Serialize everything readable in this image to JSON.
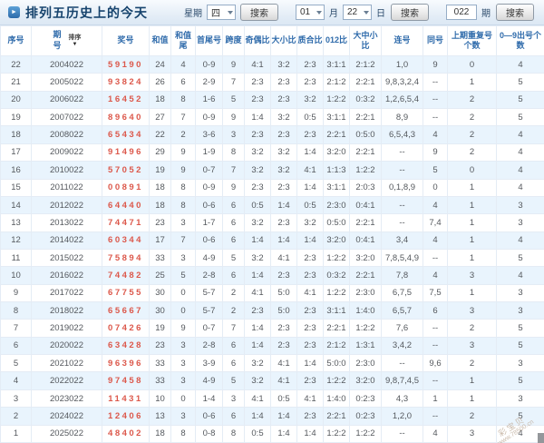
{
  "header": {
    "title": "排列五历史上的今天",
    "week_label": "星期",
    "week_value": "四",
    "month_value": "01",
    "month_label": "月",
    "day_value": "22",
    "day_label": "日",
    "issue_value": "022",
    "issue_label": "期",
    "search_label": "搜索"
  },
  "table": {
    "sort_label": "排序",
    "sort_arrow": "▼",
    "columns": [
      "序号",
      "期号",
      "奖号",
      "和值",
      "和值尾",
      "首尾号",
      "跨度",
      "奇偶比",
      "大小比",
      "质合比",
      "012比",
      "大中小比",
      "连号",
      "同号",
      "上期重复号个数",
      "0—9出号个数"
    ],
    "col_keys": [
      "seq",
      "issue",
      "number",
      "sum",
      "sum-tail",
      "first-last",
      "span",
      "odd-even-ratio",
      "big-small-ratio",
      "prime-composite-ratio",
      "zero12-ratio",
      "big-mid-small-ratio",
      "consecutive",
      "same",
      "prev-repeat-count",
      "digit-count"
    ],
    "rows": [
      [
        "22",
        "2004022",
        "59190",
        "24",
        "4",
        "0-9",
        "9",
        "4:1",
        "3:2",
        "2:3",
        "3:1:1",
        "2:1:2",
        "1,0",
        "9",
        "0",
        "4"
      ],
      [
        "21",
        "2005022",
        "93824",
        "26",
        "6",
        "2-9",
        "7",
        "2:3",
        "2:3",
        "2:3",
        "2:1:2",
        "2:2:1",
        "9,8,3,2,4",
        "--",
        "1",
        "5"
      ],
      [
        "20",
        "2006022",
        "16452",
        "18",
        "8",
        "1-6",
        "5",
        "2:3",
        "2:3",
        "3:2",
        "1:2:2",
        "0:3:2",
        "1,2,6,5,4",
        "--",
        "2",
        "5"
      ],
      [
        "19",
        "2007022",
        "89640",
        "27",
        "7",
        "0-9",
        "9",
        "1:4",
        "3:2",
        "0:5",
        "3:1:1",
        "2:2:1",
        "8,9",
        "--",
        "2",
        "5"
      ],
      [
        "18",
        "2008022",
        "65434",
        "22",
        "2",
        "3-6",
        "3",
        "2:3",
        "2:3",
        "2:3",
        "2:2:1",
        "0:5:0",
        "6,5,4,3",
        "4",
        "2",
        "4"
      ],
      [
        "17",
        "2009022",
        "91496",
        "29",
        "9",
        "1-9",
        "8",
        "3:2",
        "3:2",
        "1:4",
        "3:2:0",
        "2:2:1",
        "--",
        "9",
        "2",
        "4"
      ],
      [
        "16",
        "2010022",
        "57052",
        "19",
        "9",
        "0-7",
        "7",
        "3:2",
        "3:2",
        "4:1",
        "1:1:3",
        "1:2:2",
        "--",
        "5",
        "0",
        "4"
      ],
      [
        "15",
        "2011022",
        "00891",
        "18",
        "8",
        "0-9",
        "9",
        "2:3",
        "2:3",
        "1:4",
        "3:1:1",
        "2:0:3",
        "0,1,8,9",
        "0",
        "1",
        "4"
      ],
      [
        "14",
        "2012022",
        "64440",
        "18",
        "8",
        "0-6",
        "6",
        "0:5",
        "1:4",
        "0:5",
        "2:3:0",
        "0:4:1",
        "--",
        "4",
        "1",
        "3"
      ],
      [
        "13",
        "2013022",
        "74471",
        "23",
        "3",
        "1-7",
        "6",
        "3:2",
        "2:3",
        "3:2",
        "0:5:0",
        "2:2:1",
        "--",
        "7,4",
        "1",
        "3"
      ],
      [
        "12",
        "2014022",
        "60344",
        "17",
        "7",
        "0-6",
        "6",
        "1:4",
        "1:4",
        "1:4",
        "3:2:0",
        "0:4:1",
        "3,4",
        "4",
        "1",
        "4"
      ],
      [
        "11",
        "2015022",
        "75894",
        "33",
        "3",
        "4-9",
        "5",
        "3:2",
        "4:1",
        "2:3",
        "1:2:2",
        "3:2:0",
        "7,8,5,4,9",
        "--",
        "1",
        "5"
      ],
      [
        "10",
        "2016022",
        "74482",
        "25",
        "5",
        "2-8",
        "6",
        "1:4",
        "2:3",
        "2:3",
        "0:3:2",
        "2:2:1",
        "7,8",
        "4",
        "3",
        "4"
      ],
      [
        "9",
        "2017022",
        "67755",
        "30",
        "0",
        "5-7",
        "2",
        "4:1",
        "5:0",
        "4:1",
        "1:2:2",
        "2:3:0",
        "6,7,5",
        "7,5",
        "1",
        "3"
      ],
      [
        "8",
        "2018022",
        "65667",
        "30",
        "0",
        "5-7",
        "2",
        "2:3",
        "5:0",
        "2:3",
        "3:1:1",
        "1:4:0",
        "6,5,7",
        "6",
        "3",
        "3"
      ],
      [
        "7",
        "2019022",
        "07426",
        "19",
        "9",
        "0-7",
        "7",
        "1:4",
        "2:3",
        "2:3",
        "2:2:1",
        "1:2:2",
        "7,6",
        "--",
        "2",
        "5"
      ],
      [
        "6",
        "2020022",
        "63428",
        "23",
        "3",
        "2-8",
        "6",
        "1:4",
        "2:3",
        "2:3",
        "2:1:2",
        "1:3:1",
        "3,4,2",
        "--",
        "3",
        "5"
      ],
      [
        "5",
        "2021022",
        "96396",
        "33",
        "3",
        "3-9",
        "6",
        "3:2",
        "4:1",
        "1:4",
        "5:0:0",
        "2:3:0",
        "--",
        "9,6",
        "2",
        "3"
      ],
      [
        "4",
        "2022022",
        "97458",
        "33",
        "3",
        "4-9",
        "5",
        "3:2",
        "4:1",
        "2:3",
        "1:2:2",
        "3:2:0",
        "9,8,7,4,5",
        "--",
        "1",
        "5"
      ],
      [
        "3",
        "2023022",
        "11431",
        "10",
        "0",
        "1-4",
        "3",
        "4:1",
        "0:5",
        "4:1",
        "1:4:0",
        "0:2:3",
        "4,3",
        "1",
        "1",
        "3"
      ],
      [
        "2",
        "2024022",
        "12406",
        "13",
        "3",
        "0-6",
        "6",
        "1:4",
        "1:4",
        "2:3",
        "2:2:1",
        "0:2:3",
        "1,2,0",
        "--",
        "2",
        "5"
      ],
      [
        "1",
        "2025022",
        "48402",
        "18",
        "8",
        "0-8",
        "8",
        "0:5",
        "1:4",
        "1:4",
        "1:2:2",
        "1:2:2",
        "--",
        "4",
        "3",
        "4"
      ]
    ]
  },
  "watermark": {
    "name": "彩宝贝",
    "url": "www.78500.cn"
  },
  "colors": {
    "number_red": "#dc584b",
    "header_text_blue": "#2f6bab",
    "row_alt_bg": "#e9f4fd",
    "title_text": "#16436d"
  }
}
